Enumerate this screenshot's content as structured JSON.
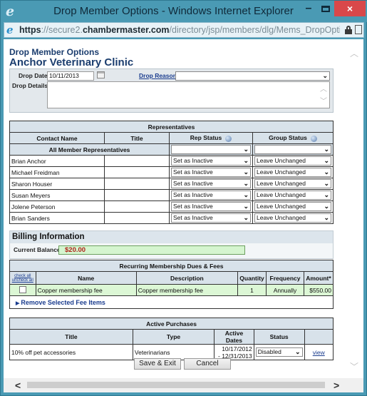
{
  "window": {
    "title": "Drop Member Options - Windows Internet Explorer",
    "minimize_glyph": "–",
    "close_glyph": "×"
  },
  "address_bar": {
    "scheme": "https",
    "sep": "://",
    "sub": "secure2.",
    "domain": "chambermaster.com",
    "path": "/directory/jsp/members/dlg/Mems_DropOptions.jsp?mer"
  },
  "page": {
    "subtitle": "Drop Member Options",
    "title": "Anchor Veterinary Clinic"
  },
  "drop_form": {
    "drop_date_label": "Drop Date:",
    "drop_date_value": "10/11/2013",
    "drop_reason_label": "Drop Reason",
    "drop_reason_colon": ":",
    "drop_reason_value": "",
    "drop_details_label": "Drop Details:",
    "drop_details_value": ""
  },
  "representatives": {
    "caption": "Representatives",
    "headers": [
      "Contact Name",
      "Title",
      "Rep Status",
      "Group Status"
    ],
    "all_label": "All Member Representatives",
    "all_rep_status": "",
    "all_group_status": "",
    "rows": [
      {
        "name": "Brian Anchor",
        "title": "",
        "rep_status": "Set as Inactive",
        "group_status": "Leave Unchanged"
      },
      {
        "name": "Michael Freidman",
        "title": "",
        "rep_status": "Set as Inactive",
        "group_status": "Leave Unchanged"
      },
      {
        "name": "Sharon Houser",
        "title": "",
        "rep_status": "Set as Inactive",
        "group_status": "Leave Unchanged"
      },
      {
        "name": "Susan Meyers",
        "title": "",
        "rep_status": "Set as Inactive",
        "group_status": "Leave Unchanged"
      },
      {
        "name": "Jolene Peterson",
        "title": "",
        "rep_status": "Set as Inactive",
        "group_status": "Leave Unchanged"
      },
      {
        "name": "Brian Sanders",
        "title": "",
        "rep_status": "Set as Inactive",
        "group_status": "Leave Unchanged"
      }
    ]
  },
  "billing": {
    "title": "Billing Information",
    "balance_label": "Current Balance:",
    "balance_value": "$20.00"
  },
  "fees": {
    "caption": "Recurring Membership Dues & Fees",
    "check_all": "check all",
    "uncheck_all": "uncheck all",
    "headers": [
      "Name",
      "Description",
      "Quantity",
      "Frequency",
      "Amount*"
    ],
    "rows": [
      {
        "checked": false,
        "name": "Copper membership fee",
        "description": "Copper membership fee",
        "quantity": "1",
        "frequency": "Annually",
        "amount": "$550.00"
      }
    ],
    "remove_label": "Remove Selected Fee Items"
  },
  "purchases": {
    "caption": "Active Purchases",
    "headers": [
      "Title",
      "Type",
      "Active Dates",
      "Status",
      ""
    ],
    "rows": [
      {
        "title": "10% off pet accessories",
        "type": "Veterinarians",
        "date_start": "10/17/2012",
        "date_end": "- 12/31/2013",
        "status": "Disabled",
        "action": "view"
      }
    ]
  },
  "buttons": {
    "save": "Save & Exit",
    "cancel": "Cancel"
  },
  "colors": {
    "frame": "#4a9ab4",
    "heading": "#1b3d6e",
    "close": "#d9484a",
    "balance_bg": "#d5f5cf",
    "balance_text": "#b0241b"
  }
}
